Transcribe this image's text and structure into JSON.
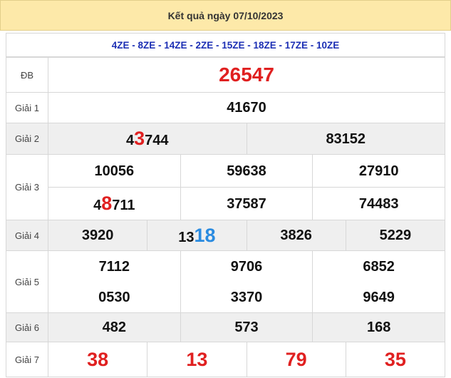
{
  "header": {
    "title": "Kết quả ngày 07/10/2023"
  },
  "codes": "4ZE - 8ZE - 14ZE - 2ZE - 15ZE - 18ZE - 17ZE - 10ZE",
  "special": {
    "label": "ĐB",
    "value": "26547"
  },
  "giai1": {
    "label": "Giải 1",
    "value": "41670"
  },
  "giai2": {
    "label": "Giải 2",
    "values": [
      {
        "pre": "4",
        "hi": "3",
        "post": "744"
      },
      {
        "pre": "83152",
        "hi": "",
        "post": ""
      }
    ]
  },
  "giai3": {
    "label": "Giải 3",
    "rows": [
      [
        {
          "pre": "10056",
          "hi": "",
          "post": ""
        },
        {
          "pre": "59638",
          "hi": "",
          "post": ""
        },
        {
          "pre": "27910",
          "hi": "",
          "post": ""
        }
      ],
      [
        {
          "pre": "4",
          "hi": "8",
          "post": "711"
        },
        {
          "pre": "37587",
          "hi": "",
          "post": ""
        },
        {
          "pre": "74483",
          "hi": "",
          "post": ""
        }
      ]
    ]
  },
  "giai4": {
    "label": "Giải 4",
    "values": [
      {
        "pre": "3920",
        "hi": ""
      },
      {
        "pre": "13",
        "hi": "18"
      },
      {
        "pre": "3826",
        "hi": ""
      },
      {
        "pre": "5229",
        "hi": ""
      }
    ]
  },
  "giai5": {
    "label": "Giải 5",
    "rows": [
      [
        "7112",
        "9706",
        "6852"
      ],
      [
        "0530",
        "3370",
        "9649"
      ]
    ]
  },
  "giai6": {
    "label": "Giải 6",
    "values": [
      "482",
      "573",
      "168"
    ]
  },
  "giai7": {
    "label": "Giải 7",
    "values": [
      "38",
      "13",
      "79",
      "35"
    ]
  },
  "colors": {
    "header_bg": "#fde9a9",
    "code_blue": "#1c2fb4",
    "highlight_red": "#e02020",
    "highlight_blue": "#2a8be0"
  }
}
